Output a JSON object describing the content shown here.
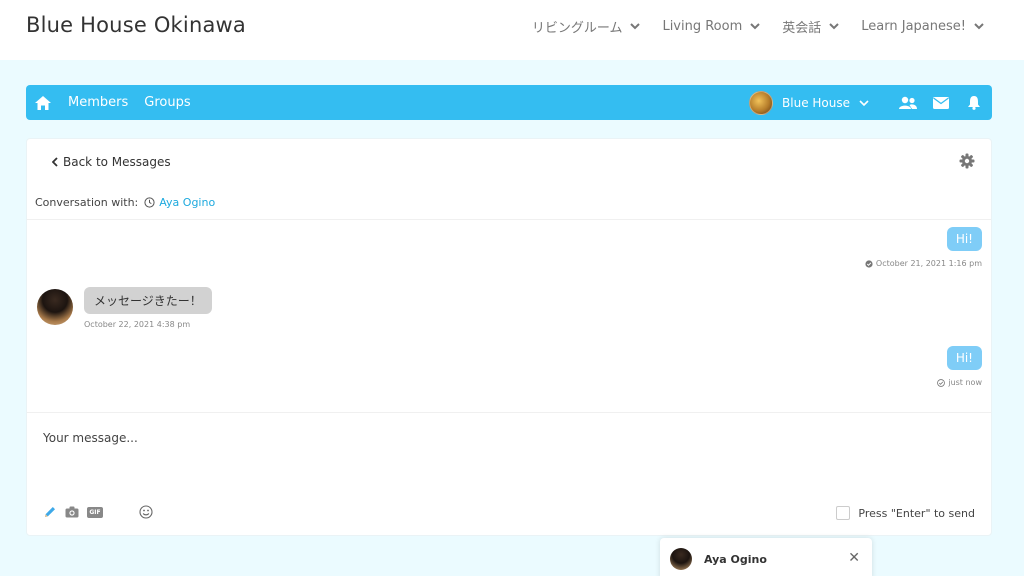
{
  "header": {
    "site_title": "Blue House Okinawa",
    "nav": [
      {
        "label": "リビングルーム"
      },
      {
        "label": "Living Room"
      },
      {
        "label": "英会話"
      },
      {
        "label": "Learn Japanese!"
      }
    ]
  },
  "buddybar": {
    "accent": "#34bdf1",
    "members_label": "Members",
    "groups_label": "Groups",
    "user_name": "Blue House"
  },
  "messages": {
    "back_label": "Back to Messages",
    "conversation_label": "Conversation with:",
    "conversation_user": "Aya Ogino",
    "thread": [
      {
        "side": "me",
        "text": "Hi!",
        "meta": "October 21, 2021 1:16 pm"
      },
      {
        "side": "them",
        "text": "メッセージきたー！",
        "meta": "October 22, 2021 4:38 pm"
      },
      {
        "side": "me",
        "text": "Hi!",
        "meta": "just now"
      }
    ],
    "composer_placeholder": "Your message...",
    "gif_label": "GIF",
    "enter_to_send_label": "Press \"Enter\" to send"
  },
  "chat_popup": {
    "name": "Aya Ogino",
    "close_glyph": "✕"
  },
  "icons": {
    "home": "home-icon",
    "friends": "friends-icon",
    "mail": "mail-icon",
    "bell": "bell-icon",
    "gear": "gear-icon",
    "clock": "clock-icon",
    "pencil": "pencil-icon",
    "camera": "camera-icon",
    "emoji": "emoji-icon",
    "check": "check-circle-icon"
  }
}
